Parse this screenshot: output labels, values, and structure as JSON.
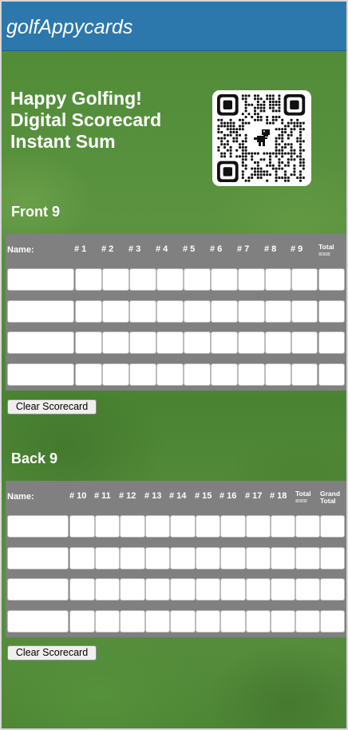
{
  "header": {
    "title": "golfAppycards"
  },
  "tagline": {
    "lines": [
      "Happy Golfing!",
      "Digital Scorecard",
      "Instant Sum"
    ]
  },
  "qr": {
    "icon": "qr-code-icon",
    "center_icon": "dinosaur-icon"
  },
  "front9": {
    "title": "Front 9",
    "headers": [
      "Name:",
      "# 1",
      "# 2",
      "# 3",
      "# 4",
      "# 5",
      "# 6",
      "# 7",
      "# 8",
      "# 9"
    ],
    "total_label": [
      "Total",
      "==="
    ],
    "rows": 4,
    "clear_label": "Clear Scorecard"
  },
  "back9": {
    "title": "Back 9",
    "headers": [
      "Name:",
      "# 10",
      "# 11",
      "# 12",
      "# 13",
      "# 14",
      "# 15",
      "# 16",
      "# 17",
      "# 18"
    ],
    "total_label": [
      "Total",
      "==="
    ],
    "grand_total_label": [
      "Grand",
      "Total"
    ],
    "rows": 4,
    "clear_label": "Clear Scorecard"
  },
  "colors": {
    "header_bar": "#2c78ad",
    "table_bg": "#808080",
    "grass": "#5a9040"
  }
}
